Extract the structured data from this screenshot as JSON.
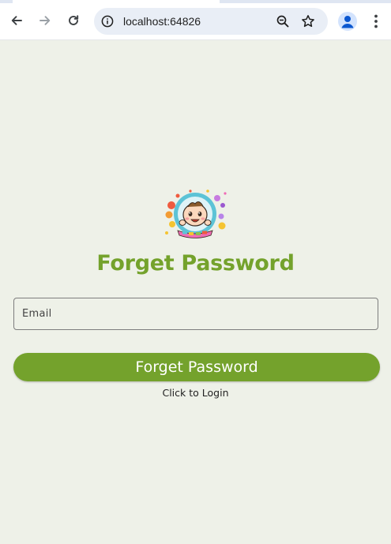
{
  "browser": {
    "url": "localhost:64826"
  },
  "form": {
    "title": "Forget Password",
    "email_placeholder": "Email",
    "submit_label": "Forget Password",
    "login_link": "Click to Login"
  },
  "colors": {
    "accent": "#74a22c",
    "page_background": "#eef1e8",
    "omnibox_background": "#e9eef6"
  },
  "icons": {
    "back": "arrow-left-icon",
    "forward": "arrow-right-icon",
    "reload": "reload-icon",
    "site_info": "info-icon",
    "zoom": "zoom-out-icon",
    "bookmark": "star-icon",
    "profile": "profile-icon",
    "menu": "kebab-menu-icon",
    "logo": "baby-logo"
  }
}
